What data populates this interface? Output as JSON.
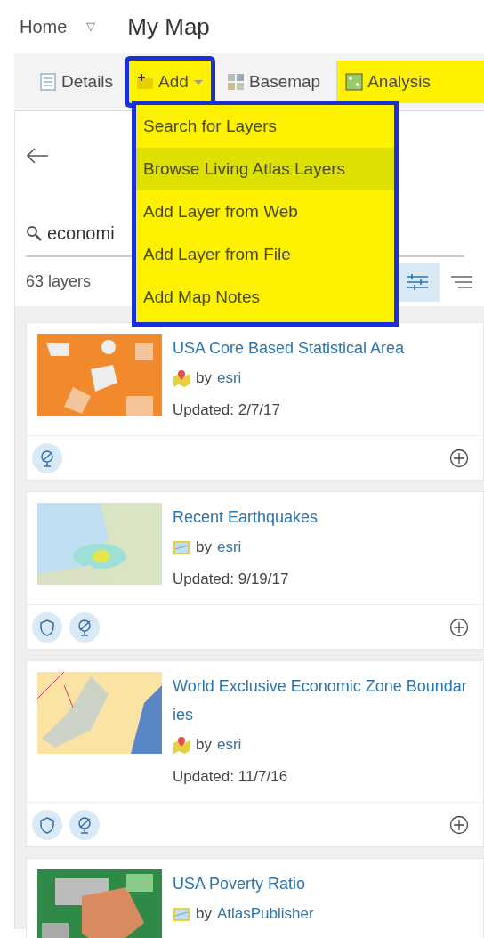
{
  "breadcrumb": {
    "home": "Home",
    "caret": "▽",
    "title": "My Map"
  },
  "tabs": [
    {
      "label": "Details",
      "highlighted": false,
      "outlined": false
    },
    {
      "label": "Add",
      "highlighted": true,
      "outlined": true
    },
    {
      "label": "Basemap",
      "highlighted": false,
      "outlined": false
    },
    {
      "label": "Analysis",
      "highlighted": true,
      "outlined": false
    }
  ],
  "menu": {
    "outlined": true,
    "items": [
      {
        "label": "Search for Layers",
        "hovered": false
      },
      {
        "label": "Browse Living Atlas Layers",
        "hovered": true
      },
      {
        "label": "Add Layer from Web",
        "hovered": false
      },
      {
        "label": "Add Layer from File",
        "hovered": false
      },
      {
        "label": "Add Map Notes",
        "hovered": false
      }
    ]
  },
  "search": {
    "value": "economi"
  },
  "count": "63 layers",
  "view_buttons": [
    {
      "kind": "filter",
      "selected": true
    },
    {
      "kind": "sort",
      "selected": false
    }
  ],
  "layers": [
    {
      "title": "USA Core Based Statistical Area",
      "kind": "map",
      "by": "by",
      "owner": "esri",
      "updated": "Updated: 2/7/17",
      "badges": [
        {
          "kind": "globe"
        }
      ]
    },
    {
      "title": "Recent Earthquakes",
      "kind": "layer",
      "by": "by",
      "owner": "esri",
      "updated": "Updated: 9/19/17",
      "badges": [
        {
          "kind": "shield"
        },
        {
          "kind": "globe"
        }
      ]
    },
    {
      "title": "World Exclusive Economic Zone Boundaries",
      "kind": "map",
      "by": "by",
      "owner": "esri",
      "updated": "Updated: 11/7/16",
      "badges": [
        {
          "kind": "shield"
        },
        {
          "kind": "globe"
        }
      ]
    },
    {
      "title": "USA Poverty Ratio",
      "kind": "layer",
      "by": "by",
      "owner": "AtlasPublisher"
    }
  ]
}
